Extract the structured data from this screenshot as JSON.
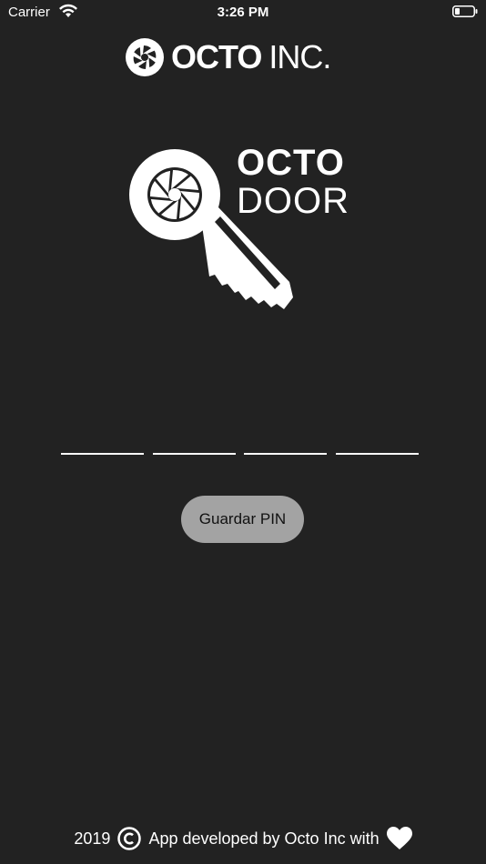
{
  "status_bar": {
    "carrier": "Carrier",
    "time": "3:26 PM"
  },
  "header": {
    "brand_strong": "OCTO",
    "brand_light": "INC."
  },
  "logo": {
    "title_line1": "OCTO",
    "title_line2": "DOOR"
  },
  "pin": {
    "digits": [
      "",
      "",
      "",
      ""
    ]
  },
  "actions": {
    "save_label": "Guardar PIN"
  },
  "footer": {
    "year": "2019",
    "text": "App developed by Octo Inc with"
  },
  "colors": {
    "background": "#222222",
    "button": "#a3a3a3",
    "foreground": "#ffffff"
  },
  "icons": [
    "wifi-icon",
    "battery-icon",
    "octo-logo-icon",
    "key-icon",
    "copyright-icon",
    "heart-icon"
  ]
}
